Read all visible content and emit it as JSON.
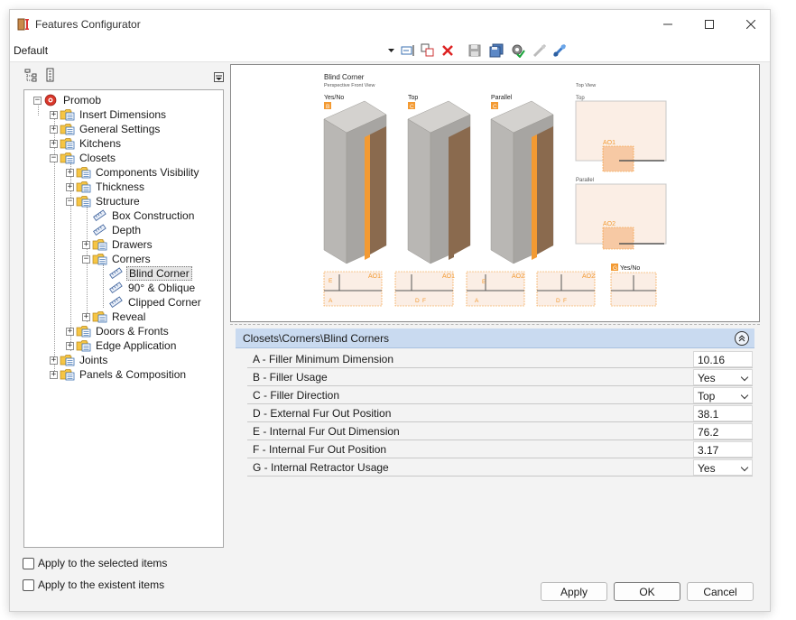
{
  "window": {
    "title": "Features Configurator"
  },
  "toolbar": {
    "profile": "Default"
  },
  "tree": {
    "nodes": [
      {
        "label": "Promob"
      },
      {
        "label": "Insert Dimensions"
      },
      {
        "label": "General Settings"
      },
      {
        "label": "Kitchens"
      },
      {
        "label": "Closets"
      },
      {
        "label": "Components Visibility"
      },
      {
        "label": "Thickness"
      },
      {
        "label": "Structure"
      },
      {
        "label": "Box Construction"
      },
      {
        "label": "Depth"
      },
      {
        "label": "Drawers"
      },
      {
        "label": "Corners"
      },
      {
        "label": "Blind Corner"
      },
      {
        "label": "90° & Oblique"
      },
      {
        "label": "Clipped Corner"
      },
      {
        "label": "Reveal"
      },
      {
        "label": "Doors & Fronts"
      },
      {
        "label": "Edge Application"
      },
      {
        "label": "Joints"
      },
      {
        "label": "Panels & Composition"
      }
    ]
  },
  "options": {
    "apply_selected": "Apply to the selected items",
    "apply_existent": "Apply to the existent items"
  },
  "preview": {
    "title": "Blind Corner",
    "subtitle": "Perspective Front View",
    "views": [
      {
        "label": "Yes/No",
        "badge": "B"
      },
      {
        "label": "Top",
        "badge": "C"
      },
      {
        "label": "Parallel",
        "badge": "C"
      }
    ],
    "top_view": "Top View",
    "top_label": "Top",
    "parallel_label": "Parallel",
    "ao1": "AO1",
    "ao2": "AO2",
    "g_badge": "G",
    "g_label": "Yes/No",
    "letter_e": "E",
    "letter_a": "A",
    "letter_d": "D",
    "letter_f": "F"
  },
  "properties": {
    "path": "Closets\\Corners\\Blind Corners",
    "rows": [
      {
        "name": "A - Filler Minimum Dimension",
        "value": "10.16"
      },
      {
        "name": "B - Filler Usage",
        "value": "Yes"
      },
      {
        "name": "C - Filler Direction",
        "value": "Top"
      },
      {
        "name": "D - External Fur Out Position",
        "value": "38.1"
      },
      {
        "name": "E - Internal Fur Out Dimension",
        "value": "76.2"
      },
      {
        "name": "F - Internal Fur Out Position",
        "value": "3.17"
      },
      {
        "name": "G - Internal Retractor Usage",
        "value": "Yes"
      }
    ]
  },
  "buttons": {
    "apply": "Apply",
    "ok": "OK",
    "cancel": "Cancel"
  },
  "colors": {
    "accent_orange": "#f39a32",
    "header_blue": "#c9daf0",
    "cabinet_grey": "#bdbbb8",
    "wood": "#8a6a4e"
  }
}
